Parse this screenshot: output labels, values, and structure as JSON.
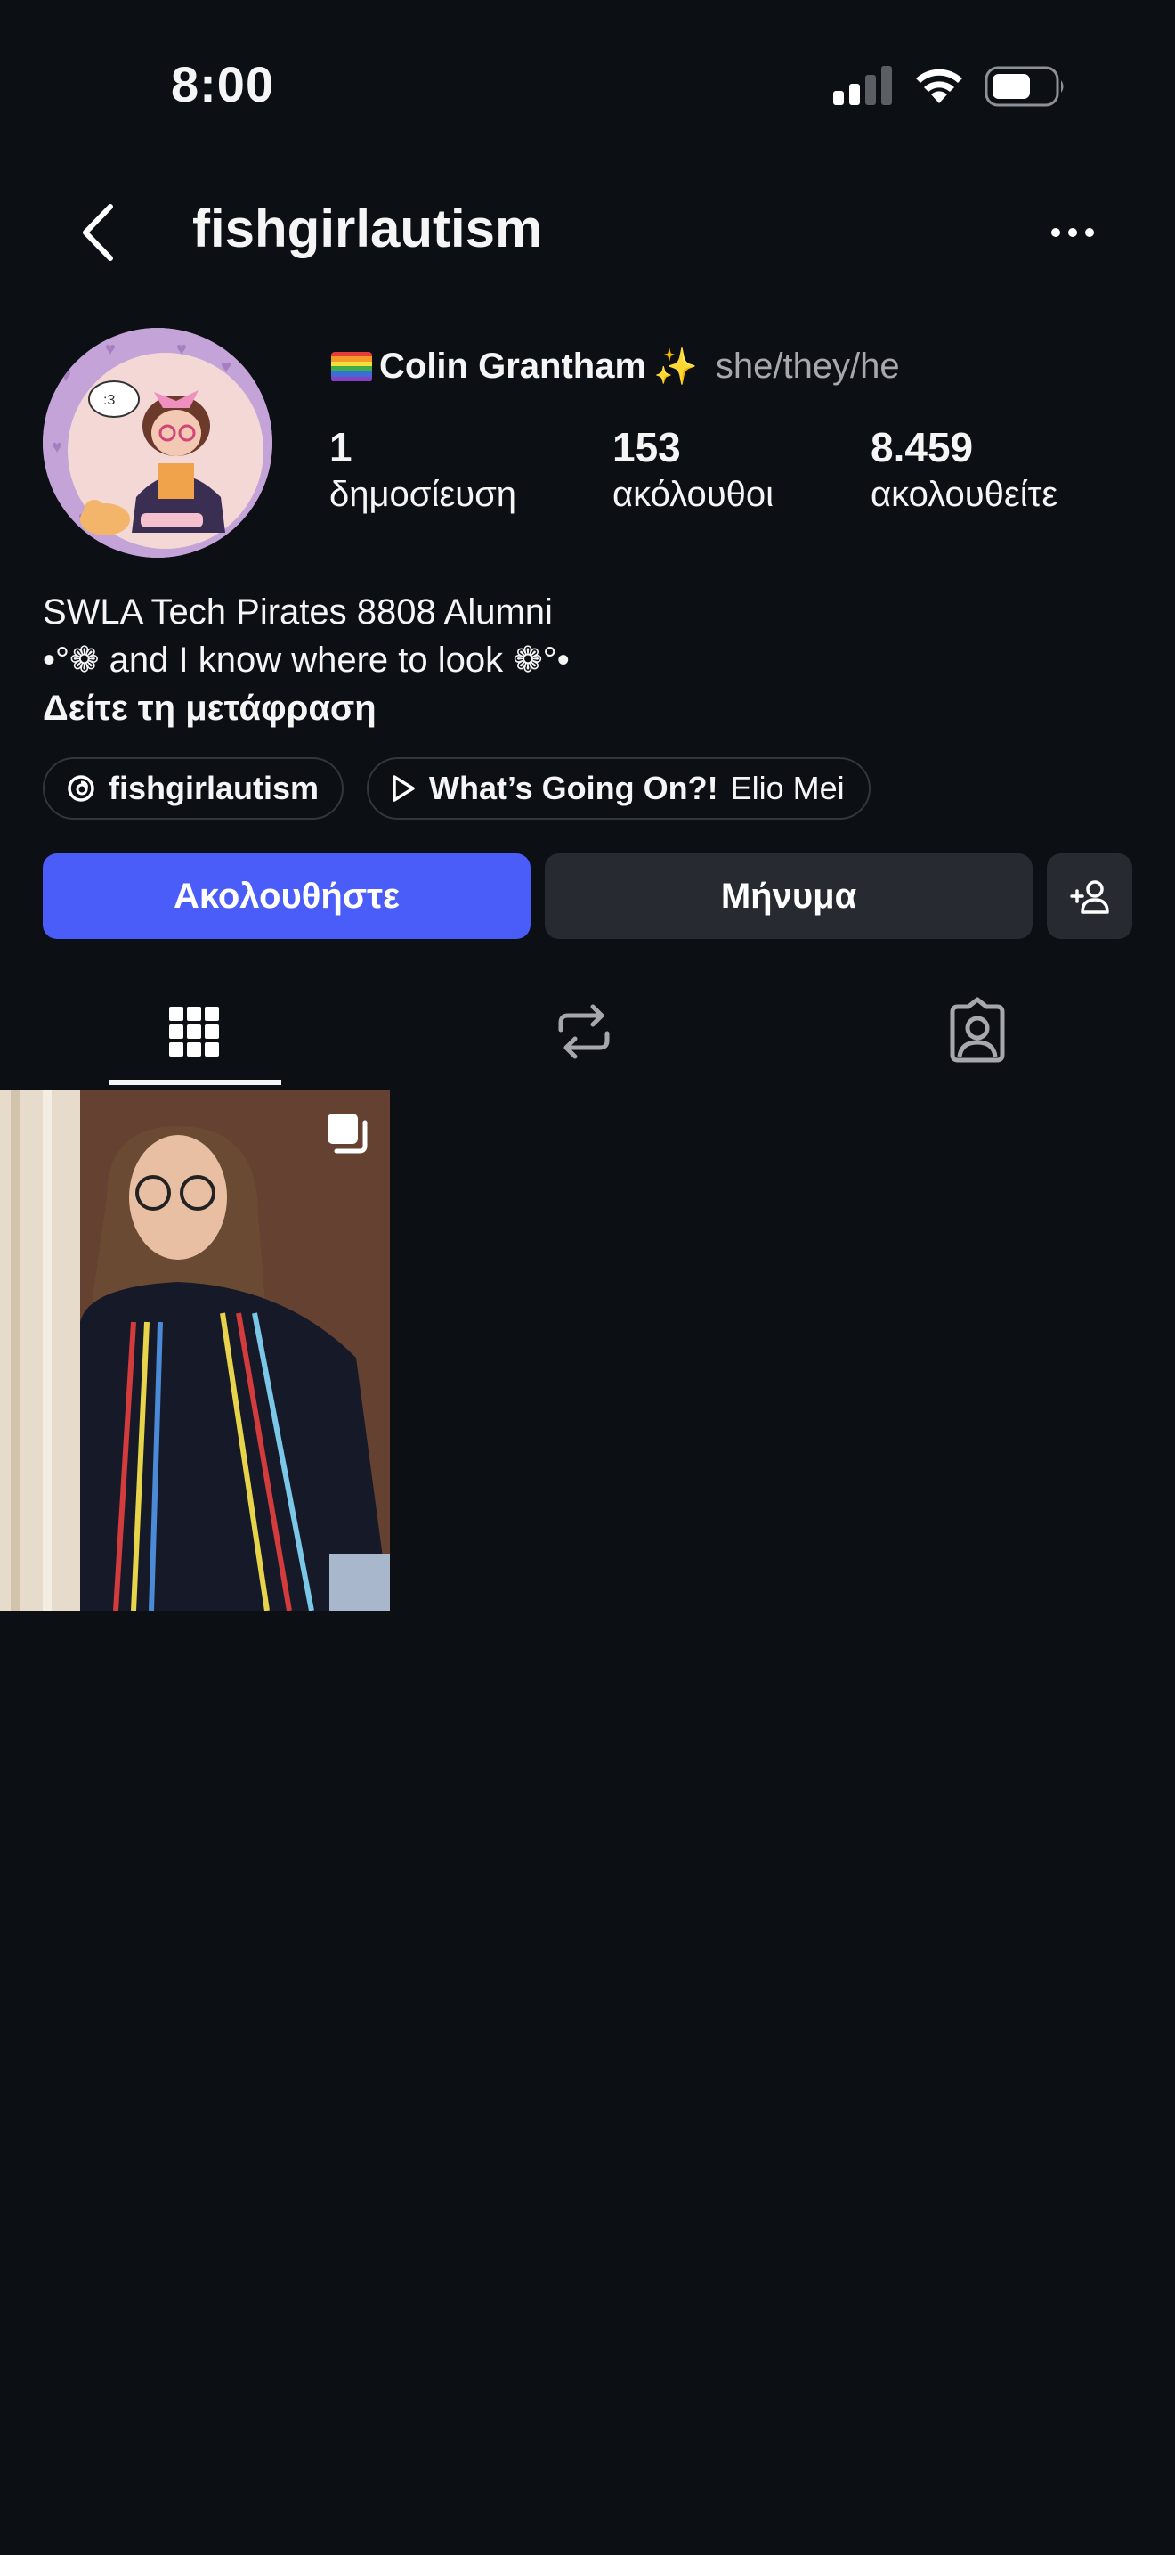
{
  "status_bar": {
    "time": "8:00"
  },
  "header": {
    "username": "fishgirlautism"
  },
  "profile": {
    "full_name": "Colin Grantham",
    "sparkle": "✨",
    "pronouns": "she/they/he",
    "stats": [
      {
        "value": "1",
        "label": "δημοσίευση"
      },
      {
        "value": "153",
        "label": "ακόλουθοι"
      },
      {
        "value": "8.459",
        "label": "ακολουθείτε"
      }
    ],
    "bio_line1": "SWLA Tech Pirates 8808 Alumni",
    "bio_line2": "•°❁ and I know where to look ❁°•",
    "translation_link": "Δείτε τη μετάφραση"
  },
  "chips": {
    "threads_label": "fishgirlautism",
    "music_title": "What’s Going On?!",
    "music_artist": "Elio Mei"
  },
  "buttons": {
    "follow_label": "Ακολουθήστε",
    "message_label": "Μήνυμα"
  },
  "colors": {
    "background": "#0c0f14",
    "follow_button": "#4a5df9",
    "secondary_button": "#272a30"
  },
  "icons": {
    "back": "chevron-left-icon",
    "more": "more-horizontal-icon",
    "threads": "threads-icon",
    "music": "play-icon",
    "add_person": "add-person-icon",
    "tab_grid": "grid-icon",
    "tab_reposts": "repost-icon",
    "tab_tagged": "tagged-icon",
    "post_multi": "carousel-icon"
  }
}
